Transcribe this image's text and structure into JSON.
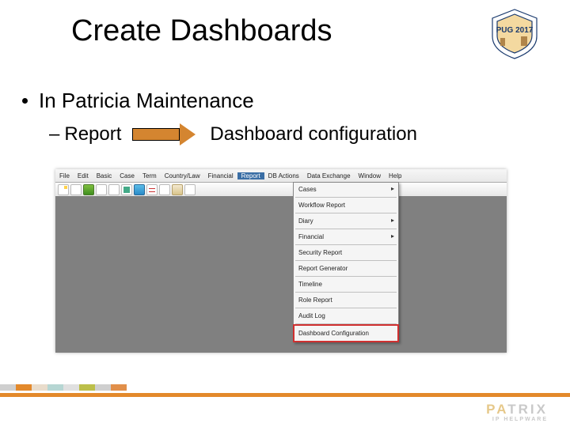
{
  "title": "Create Dashboards",
  "logo": {
    "line1": "PUG 2017"
  },
  "bullet1": "In Patricia Maintenance",
  "bullet2_left": "Report",
  "bullet2_right": "Dashboard configuration",
  "screenshot": {
    "menubar": [
      "File",
      "Edit",
      "Basic",
      "Case",
      "Term",
      "Country/Law",
      "Financial",
      "Report",
      "DB Actions",
      "Data Exchange",
      "Window",
      "Help"
    ],
    "active_menu_index": 7,
    "dropdown": [
      {
        "label": "Cases",
        "sub": true
      },
      {
        "label": "Workflow Report"
      },
      {
        "label": "Diary",
        "sub": true
      },
      {
        "label": "Financial",
        "sub": true
      },
      {
        "label": "Security Report"
      },
      {
        "label": "Report Generator"
      },
      {
        "label": "Timeline"
      },
      {
        "label": "Role Report"
      },
      {
        "label": "Audit Log"
      },
      {
        "label": "Dashboard Configuration",
        "highlight": true
      }
    ]
  },
  "footer": {
    "brand": "PATRIX",
    "tagline": "IP HELPWARE"
  },
  "stripes": [
    "#cfcfcf",
    "#e3892b",
    "#e9dccb",
    "#b6d6d3",
    "#e0e0e0",
    "#bcbf4a",
    "#cfcfcf",
    "#e18f4a"
  ]
}
